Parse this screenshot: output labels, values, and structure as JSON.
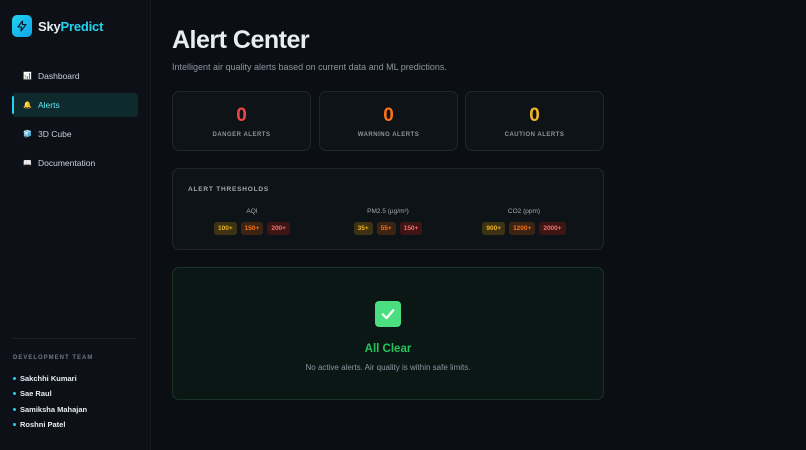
{
  "brand": {
    "name_part1": "Sky",
    "name_part2": "Predict",
    "accent": "#22d3ee"
  },
  "nav": [
    {
      "label": "Dashboard",
      "icon": "chart-icon",
      "glyph": "📊",
      "active": false
    },
    {
      "label": "Alerts",
      "icon": "bell-icon",
      "glyph": "🔔",
      "active": true
    },
    {
      "label": "3D Cube",
      "icon": "cube-icon",
      "glyph": "🧊",
      "active": false
    },
    {
      "label": "Documentation",
      "icon": "book-icon",
      "glyph": "📖",
      "active": false
    }
  ],
  "team": {
    "heading": "DEVELOPMENT TEAM",
    "members": [
      "Sakchhi Kumari",
      "Sae Raul",
      "Samiksha Mahajan",
      "Roshni Patel"
    ]
  },
  "header": {
    "title": "Alert Center",
    "subtitle": "Intelligent air quality alerts based on current data and ML predictions."
  },
  "cards": [
    {
      "value": "0",
      "label": "DANGER ALERTS",
      "color": "#ef4444"
    },
    {
      "value": "0",
      "label": "WARNING ALERTS",
      "color": "#f97316"
    },
    {
      "value": "0",
      "label": "CAUTION ALERTS",
      "color": "#f0b429"
    }
  ],
  "thresholds": {
    "heading": "ALERT THRESHOLDS",
    "groups": [
      {
        "name": "AQI",
        "values": [
          "100+",
          "150+",
          "200+"
        ]
      },
      {
        "name": "PM2.5 (µg/m³)",
        "values": [
          "35+",
          "55+",
          "150+"
        ]
      },
      {
        "name": "CO2 (ppm)",
        "values": [
          "900+",
          "1200+",
          "2000+"
        ]
      }
    ]
  },
  "status": {
    "icon": "check-icon",
    "title": "All Clear",
    "message": "No active alerts. Air quality is within safe limits."
  }
}
